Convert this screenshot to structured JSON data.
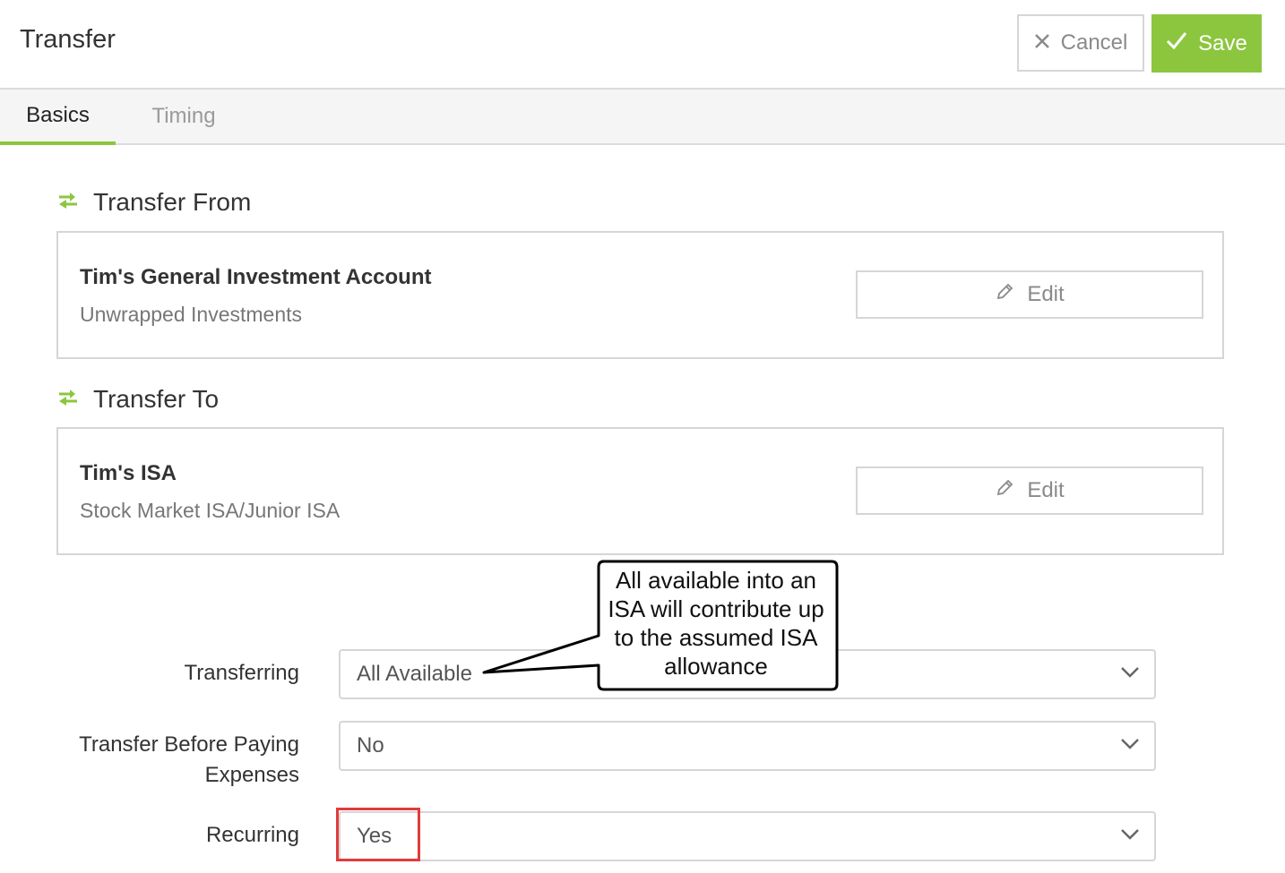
{
  "header": {
    "title": "Transfer",
    "cancel_label": "Cancel",
    "save_label": "Save"
  },
  "tabs": [
    {
      "label": "Basics",
      "active": true
    },
    {
      "label": "Timing",
      "active": false
    }
  ],
  "transfer_from": {
    "title": "Transfer From",
    "account_name": "Tim's General Investment Account",
    "account_type": "Unwrapped Investments",
    "edit_label": "Edit"
  },
  "transfer_to": {
    "title": "Transfer To",
    "account_name": "Tim's ISA",
    "account_type": "Stock Market ISA/Junior ISA",
    "edit_label": "Edit"
  },
  "fields": {
    "transferring": {
      "label": "Transferring",
      "value": "All Available"
    },
    "before_expenses": {
      "label_line1": "Transfer Before Paying",
      "label_line2": "Expenses",
      "value": "No"
    },
    "recurring": {
      "label": "Recurring",
      "value": "Yes"
    }
  },
  "callout": {
    "line1": "All available into an",
    "line2": "ISA will contribute up",
    "line3": "to the assumed ISA",
    "line4": "allowance"
  },
  "colors": {
    "accent": "#8cc63f",
    "highlight": "#e23b3b",
    "border": "#d6d6d6"
  }
}
